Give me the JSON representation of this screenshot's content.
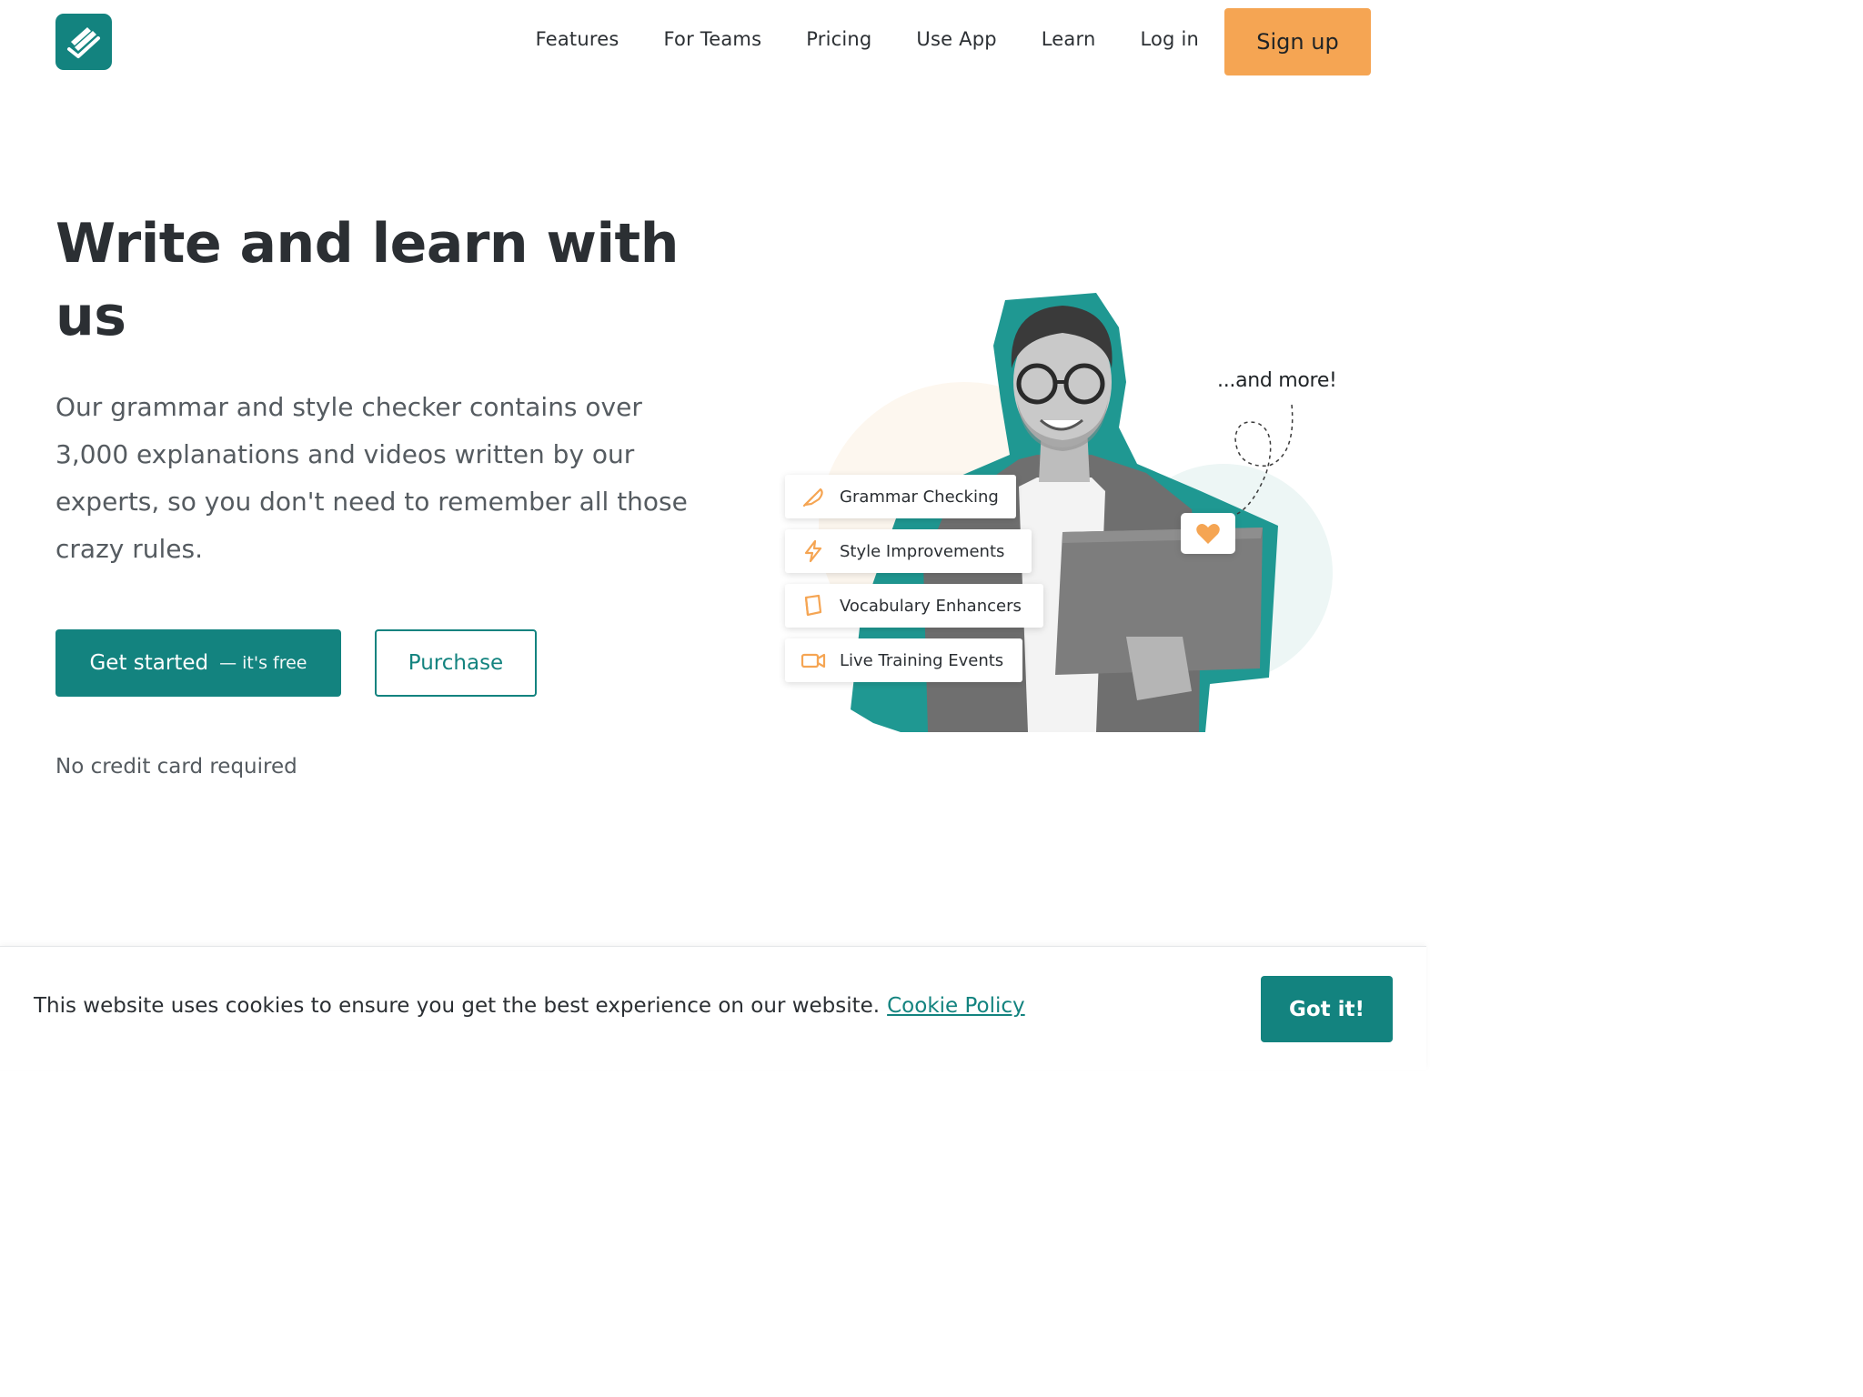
{
  "header": {
    "nav": [
      {
        "label": "Features"
      },
      {
        "label": "For Teams"
      },
      {
        "label": "Pricing"
      },
      {
        "label": "Use App"
      },
      {
        "label": "Learn"
      },
      {
        "label": "Log in"
      }
    ],
    "signup_label": "Sign up",
    "logo_icon": "feather-check-icon"
  },
  "hero": {
    "title": "Write and learn with us",
    "description": "Our grammar and style checker contains over 3,000 explanations and videos written by our experts, so you don't need to remember all those crazy rules.",
    "primary_button": {
      "main": "Get started",
      "sub": "— it's free"
    },
    "secondary_button": "Purchase",
    "note": "No credit card required"
  },
  "illustration": {
    "features": [
      {
        "label": "Grammar Checking",
        "icon": "feather-pen-icon"
      },
      {
        "label": "Style Improvements",
        "icon": "lightning-icon"
      },
      {
        "label": "Vocabulary Enhancers",
        "icon": "book-icon"
      },
      {
        "label": "Live Training Events",
        "icon": "video-camera-icon"
      }
    ],
    "more_label": "...and more!",
    "badge_icon": "heart-icon"
  },
  "cookie": {
    "text": "This website uses cookies to ensure you get the best experience on our website.",
    "link": "Cookie Policy",
    "button": "Got it!"
  },
  "colors": {
    "brand": "#13837f",
    "accent": "#f5a553",
    "text": "#2b2f33",
    "muted": "#555b60"
  }
}
